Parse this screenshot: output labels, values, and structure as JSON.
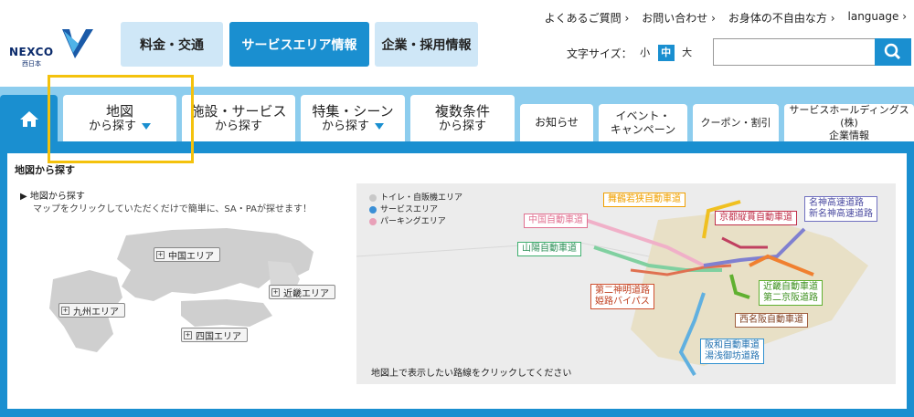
{
  "header": {
    "logo_text": "NEXCO",
    "logo_sub": "西日本",
    "nav": [
      "料金・交通",
      "サービスエリア情報",
      "企業・採用情報"
    ],
    "top_links": [
      "よくあるご質問 ›",
      "お問い合わせ ›",
      "お身体の不自由な方 ›",
      "language ›"
    ],
    "font_size_label": "文字サイズ：",
    "font_sizes": [
      "小",
      "中",
      "大"
    ],
    "search_placeholder": ""
  },
  "tabs": [
    {
      "line1": "地図",
      "line2": "から探す"
    },
    {
      "line1": "施設・サービス",
      "line2": "から探す"
    },
    {
      "line1": "特集・シーン",
      "line2": "から探す"
    },
    {
      "line1": "複数条件",
      "line2": "から探す"
    },
    {
      "line1": "お知らせ"
    },
    {
      "line1": "イベント・",
      "line2": "キャンペーン"
    },
    {
      "line1": "クーポン・割引"
    },
    {
      "line1": "サービスホールディングス(株)",
      "line2": "企業情報"
    }
  ],
  "panel": {
    "title": "地図から探す",
    "sub": "▶ 地図から探す",
    "desc": "マップをクリックしていただくだけで簡単に、SA・PAが探せます！",
    "regions": [
      "中国エリア",
      "近畿エリア",
      "九州エリア",
      "四国エリア"
    ]
  },
  "map": {
    "legend": [
      {
        "label": "トイレ・自販機エリア",
        "color": "#c8c8c8"
      },
      {
        "label": "サービスエリア",
        "color": "#3a8fd6"
      },
      {
        "label": "パーキングエリア",
        "color": "#e8a0b8"
      }
    ],
    "note": "地図上で表示したい路線をクリックしてください",
    "roads": [
      {
        "label": "中国自動車道",
        "color": "#e07090"
      },
      {
        "label": "舞鶴若狭自動車道",
        "color": "#f0a000"
      },
      {
        "label": "名神高速道路",
        "color": "#7070c0"
      },
      {
        "label": "新名神高速道路",
        "color": "#7070c0"
      },
      {
        "label": "京都縦貫自動車道",
        "color": "#c0304a"
      },
      {
        "label": "山陽自動車道",
        "color": "#40b070"
      },
      {
        "label": "第二神明道路",
        "color": "#d05030"
      },
      {
        "label": "姫路バイパス",
        "color": "#d05030"
      },
      {
        "label": "近畿自動車道",
        "color": "#60b030"
      },
      {
        "label": "第二京阪道路",
        "color": "#60b030"
      },
      {
        "label": "西名阪自動車道",
        "color": "#a06040"
      },
      {
        "label": "阪和自動車道",
        "color": "#3090d0"
      },
      {
        "label": "湯浅御坊道路",
        "color": "#3090d0"
      }
    ]
  },
  "colors": {
    "accent": "#1a8fd0",
    "light": "#cfe7f7",
    "bar": "#8dcdee"
  }
}
